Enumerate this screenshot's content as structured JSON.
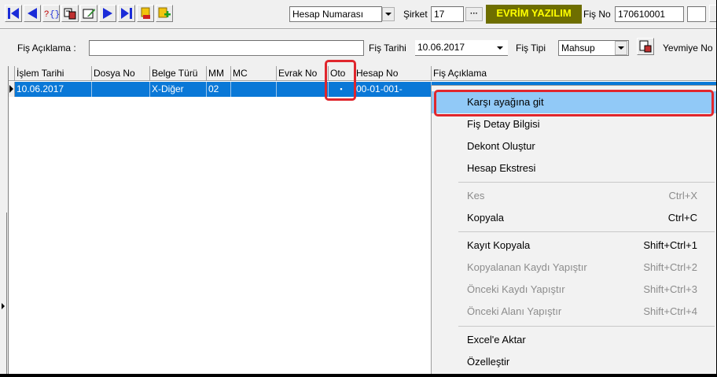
{
  "toolbar": {
    "buttons": [
      "first-record",
      "previous-record",
      "search-filter",
      "print-preview",
      "edit-record",
      "next-record",
      "last-record",
      "delete-record",
      "add-record"
    ],
    "account_select": "Hesap Numarası",
    "company_label": "Şirket",
    "company_value": "17",
    "ellipsis": "···",
    "brand": "EVRİM YAZILIM",
    "voucher_no_label": "Fiş No",
    "voucher_no_value": "170610001"
  },
  "header": {
    "desc_label": "Fiş Açıklama :",
    "desc_value": "",
    "date_label": "Fiş Tarihi",
    "date_value": "10.06.2017",
    "type_label": "Fiş  Tipi",
    "type_value": "Mahsup",
    "journal_label": "Yevmiye No"
  },
  "grid": {
    "columns": [
      "İşlem Tarihi",
      "Dosya No",
      "Belge Türü",
      "MM",
      "MC",
      "Evrak No",
      "Oto",
      "Hesap No",
      "Fiş Açıklama"
    ],
    "rows": [
      [
        "10.06.2017",
        "",
        "X-Diğer",
        "02",
        "",
        "",
        "▪",
        "00-01-001-",
        ""
      ]
    ]
  },
  "context_menu": {
    "items": [
      {
        "label": "Karşı ayağına git",
        "shortcut": "",
        "disabled": false,
        "highlighted": true
      },
      {
        "label": "Fiş Detay Bilgisi",
        "shortcut": "",
        "disabled": false
      },
      {
        "label": "Dekont Oluştur",
        "shortcut": "",
        "disabled": false
      },
      {
        "label": "Hesap Ekstresi",
        "shortcut": "",
        "disabled": false
      },
      {
        "label": "Kes",
        "shortcut": "Ctrl+X",
        "disabled": true
      },
      {
        "label": "Kopyala",
        "shortcut": "Ctrl+C",
        "disabled": false
      },
      {
        "label": "Kayıt Kopyala",
        "shortcut": "Shift+Ctrl+1",
        "disabled": false
      },
      {
        "label": "Kopyalanan Kaydı Yapıştır",
        "shortcut": "Shift+Ctrl+2",
        "disabled": true
      },
      {
        "label": "Önceki Kaydı Yapıştır",
        "shortcut": "Shift+Ctrl+3",
        "disabled": true
      },
      {
        "label": "Önceki Alanı Yapıştır",
        "shortcut": "Shift+Ctrl+4",
        "disabled": true
      },
      {
        "label": "Excel'e Aktar",
        "shortcut": "",
        "disabled": false
      },
      {
        "label": "Özelleştir",
        "shortcut": "",
        "disabled": false
      }
    ]
  },
  "colors": {
    "selection": "#0a78d7",
    "menu_highlight": "#91c9f7",
    "annotation_red": "#e0262d",
    "nav_blue": "#1a2bd8"
  }
}
